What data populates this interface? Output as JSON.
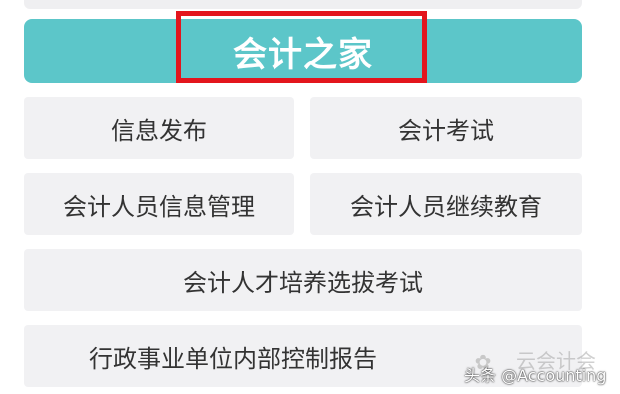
{
  "header": {
    "title": "会计之家"
  },
  "menu": {
    "items": [
      {
        "label": "信息发布"
      },
      {
        "label": "会计考试"
      },
      {
        "label": "会计人员信息管理"
      },
      {
        "label": "会计人员继续教育"
      },
      {
        "label": "会计人才培养选拔考试"
      },
      {
        "label": "行政事业单位内部控制报告"
      }
    ]
  },
  "watermark": {
    "faded_text": "云会计会",
    "text": "头条 @Accounting"
  },
  "colors": {
    "header_bg": "#5cc6c9",
    "highlight_border": "#e3151d",
    "tile_bg": "#f1f1f3",
    "text": "#333333"
  }
}
